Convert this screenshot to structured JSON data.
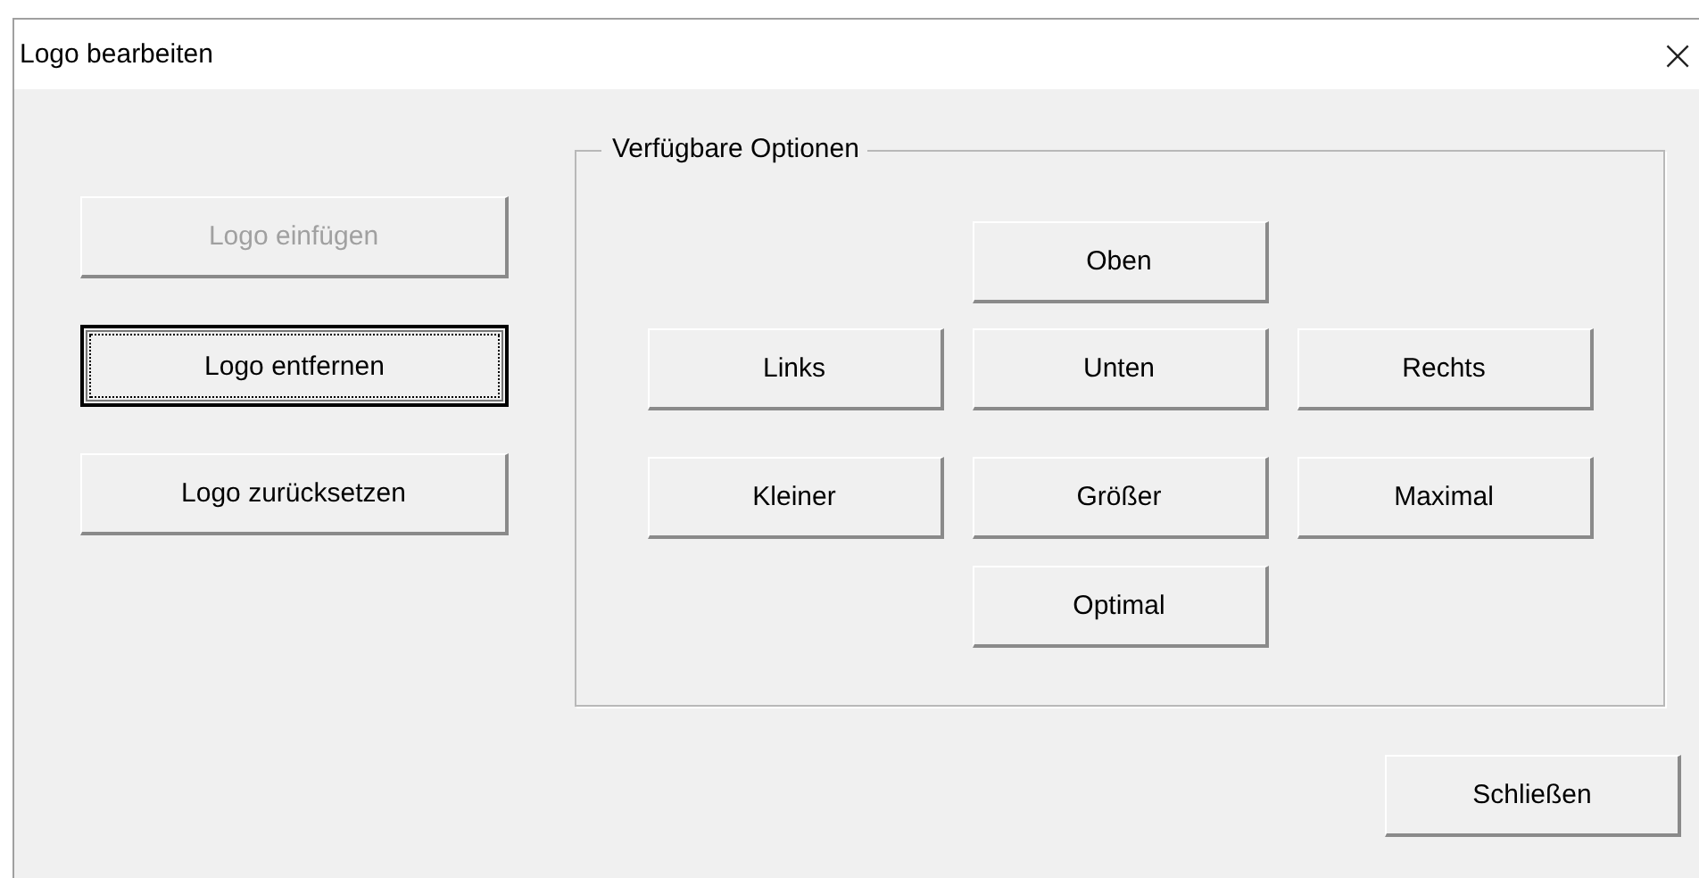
{
  "window": {
    "title": "Logo bearbeiten",
    "close": "×"
  },
  "logo_buttons": [
    {
      "label": "Logo einfügen",
      "disabled": true,
      "focused": false
    },
    {
      "label": "Logo entfernen",
      "disabled": false,
      "focused": true
    },
    {
      "label": "Logo zurücksetzen",
      "disabled": false,
      "focused": false
    }
  ],
  "options": {
    "title": "Verfügbare Optionen",
    "rows": [
      {
        "buttons": [
          "Oben"
        ]
      },
      {
        "buttons": [
          "Links",
          "Unten",
          "Rechts"
        ]
      },
      {
        "buttons": [
          "Kleiner",
          "Größer",
          "Maximal"
        ]
      },
      {
        "buttons": [
          "Optimal"
        ]
      }
    ]
  },
  "footer_buttons": [
    "Schließen"
  ]
}
